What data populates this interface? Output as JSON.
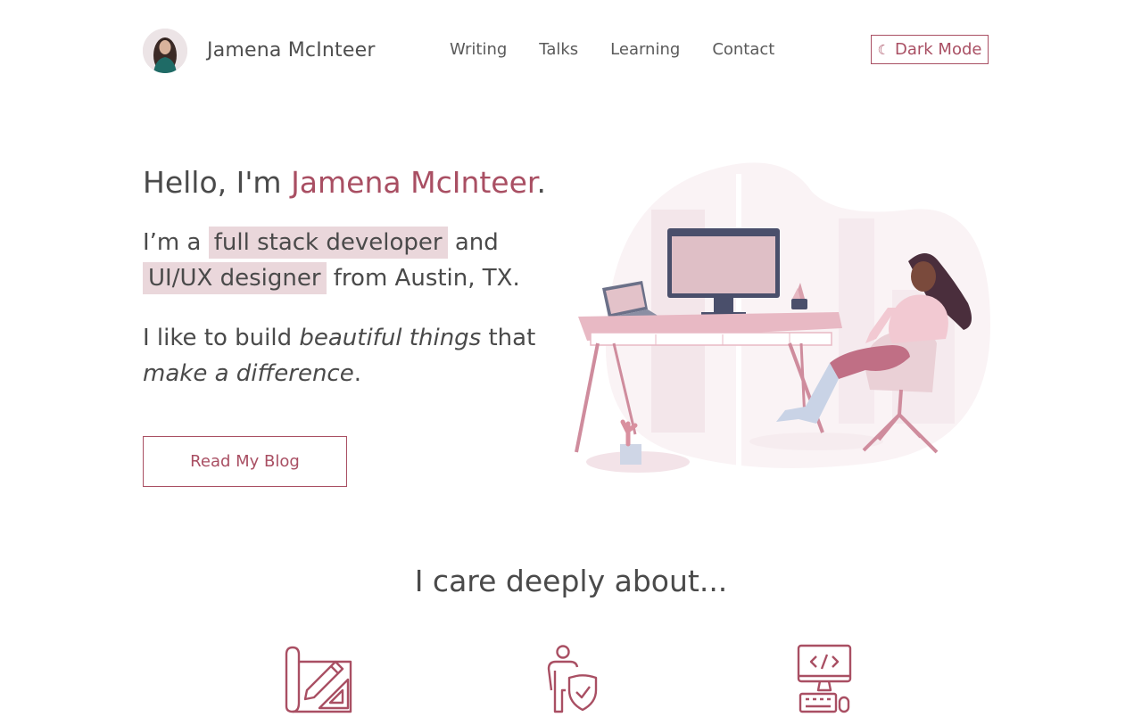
{
  "header": {
    "site_name": "Jamena McInteer",
    "avatar_icon": "profile-photo",
    "nav": [
      "Writing",
      "Talks",
      "Learning",
      "Contact"
    ],
    "dark_mode": {
      "icon": "moon-icon",
      "label": "Dark Mode"
    }
  },
  "hero": {
    "hello_prefix": "Hello, I'm ",
    "name": "Jamena McInteer",
    "hello_suffix": ".",
    "line1_prefix": "I’m a ",
    "role1": "full stack developer",
    "line1_suffix": " and",
    "role2": "UI/UX designer",
    "line2_suffix": " from Austin, TX.",
    "line3_prefix": "I like to build ",
    "line3_em": "beautiful things",
    "line3_suffix": " that",
    "line4_em": "make a difference",
    "line4_suffix": ".",
    "cta": "Read My Blog",
    "illustration_icon": "woman-at-desk-illustration"
  },
  "care": {
    "title": "I care deeply about...",
    "icons": [
      "design-blueprint-icon",
      "person-shield-icon",
      "computer-code-icon"
    ]
  },
  "colors": {
    "accent": "#a94f63",
    "highlight": "#ead7db",
    "text": "#4a4a4a"
  }
}
